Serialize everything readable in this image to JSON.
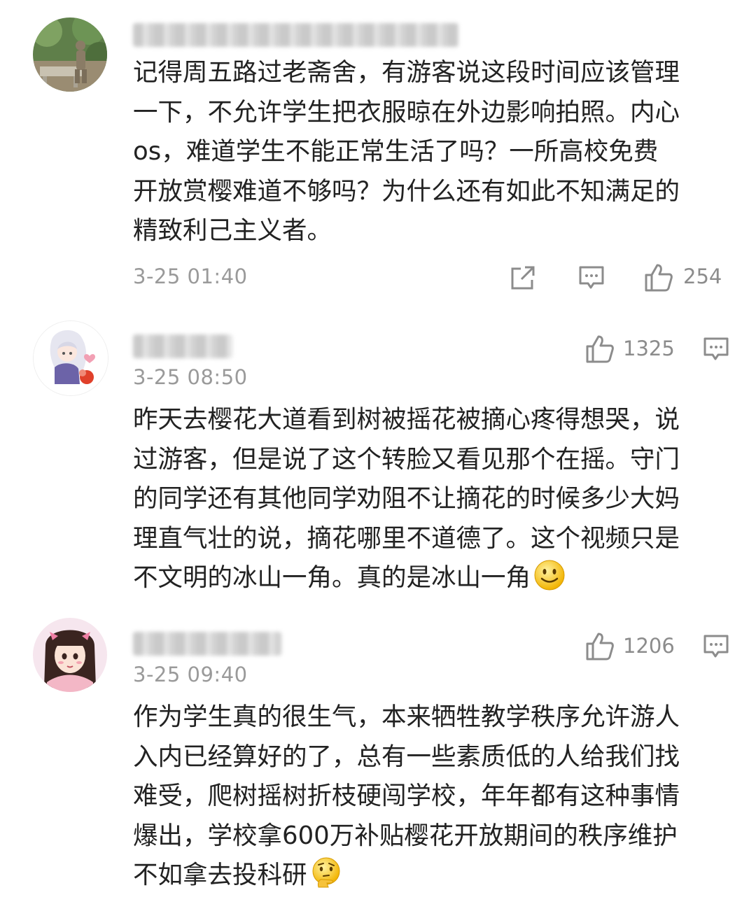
{
  "comments": [
    {
      "text": "记得周五路过老斋舍，有游客说这段时间应该管理\n一下，不允许学生把衣服晾在外边影响拍照。内心\nos，难道学生不能正常生活了吗？一所高校免费\n开放赏樱难道不够吗？为什么还有如此不知满足的\n精致利己主义者。",
      "time": "3-25 01:40",
      "likes": "254",
      "icons": [
        "share-icon",
        "comment-icon",
        "thumbs-up-icon"
      ]
    },
    {
      "text": "昨天去樱花大道看到树被摇花被摘心疼得想哭，说\n过游客，但是说了这个转脸又看见那个在摇。守门\n的同学还有其他同学劝阻不让摘花的时候多少大妈\n理直气壮的说，摘花哪里不道德了。这个视频只是\n不文明的冰山一角。真的是冰山一角",
      "time": "3-25 08:50",
      "likes": "1325",
      "icons": [
        "thumbs-up-icon",
        "comment-icon",
        "smile-emoji-icon"
      ]
    },
    {
      "text": "作为学生真的很生气，本来牺牲教学秩序允许游人\n入内已经算好的了，总有一些素质低的人给我们找\n难受，爬树摇树折枝硬闯学校，年年都有这种事情\n爆出，学校拿600万补贴樱花开放期间的秩序维护\n不如拿去投科研",
      "time": "3-25 09:40",
      "likes": "1206",
      "icons": [
        "thumbs-up-icon",
        "comment-icon",
        "thinking-emoji-icon"
      ]
    }
  ],
  "colors": {
    "text": "#222222",
    "meta": "#9a9a9a",
    "icon": "#8c8c8c",
    "background": "#ffffff"
  }
}
